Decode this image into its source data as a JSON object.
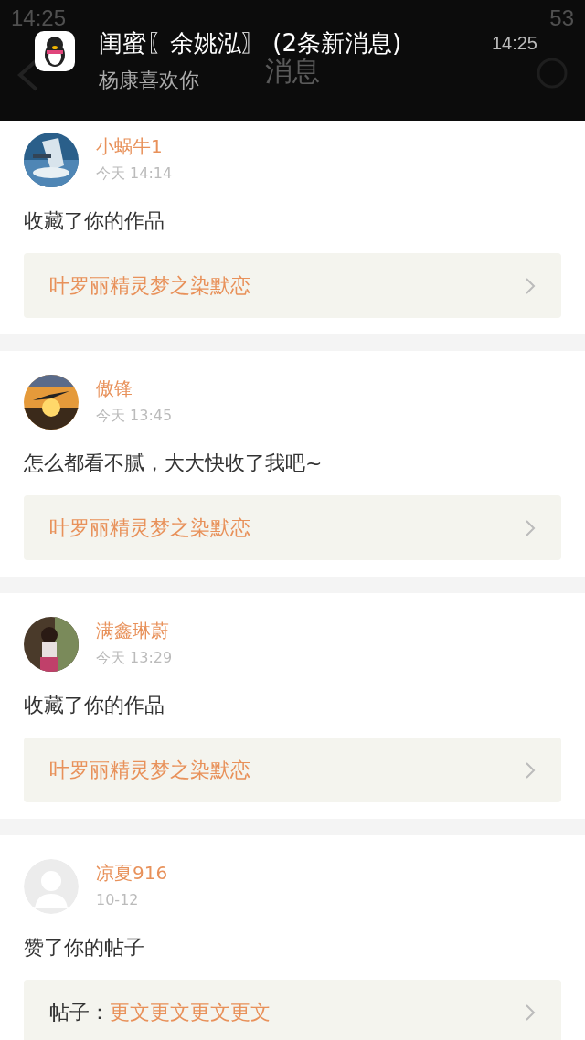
{
  "status_bar": {
    "time": "14:25",
    "battery": "53"
  },
  "header": {
    "title": "消息"
  },
  "notification": {
    "title": "闺蜜〖余姚泓〗 (2条新消息)",
    "message": "杨康喜欢你",
    "time": "14:25"
  },
  "messages": [
    {
      "user": "小蜗牛1",
      "time": "今天 14:14",
      "text": "收藏了你的作品",
      "link": {
        "title": "叶罗丽精灵梦之染默恋"
      }
    },
    {
      "user": "傲锋",
      "time": "今天 13:45",
      "text": "怎么都看不腻，大大快收了我吧~",
      "link": {
        "title": "叶罗丽精灵梦之染默恋"
      }
    },
    {
      "user": "满鑫琳蔚",
      "time": "今天 13:29",
      "text": "收藏了你的作品",
      "link": {
        "title": "叶罗丽精灵梦之染默恋"
      }
    },
    {
      "user": "凉夏916",
      "time": "10-12",
      "avatar": {
        "kind": "default"
      },
      "text": "赞了你的帖子",
      "link": {
        "prefix": "帖子：",
        "title": "更文更文更文更文"
      }
    }
  ]
}
